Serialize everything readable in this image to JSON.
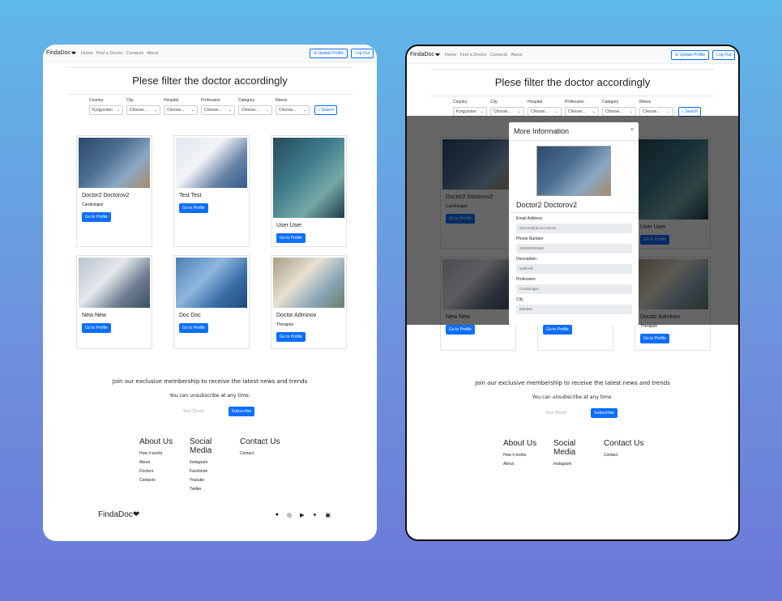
{
  "nav": {
    "brand": "FindaDoc",
    "links": [
      "Home",
      "Find a Doctor",
      "Contacts",
      "About"
    ],
    "update_profile": "⊚ Update Profile",
    "logout": "Log Out"
  },
  "page": {
    "title": "Plese filter the doctor accordingly"
  },
  "filters": {
    "labels": [
      "Country",
      "City",
      "Hospital",
      "Profession",
      "Category",
      "Illness"
    ],
    "values": [
      "Kyrgyzstan",
      "Choose...",
      "Choose...",
      "Choose...",
      "Choose...",
      "Choose..."
    ],
    "search": "⌕ Search"
  },
  "doctors": [
    {
      "name": "Doctor2 Doctorov2",
      "profession": "Cardiologist",
      "button": "Go to Profile"
    },
    {
      "name": "Test Test",
      "profession": "",
      "button": "Go to Profile"
    },
    {
      "name": "User User",
      "profession": "",
      "button": "Go to Profile"
    },
    {
      "name": "New New",
      "profession": "",
      "button": "Go to Profile"
    },
    {
      "name": "Doc Doc",
      "profession": "",
      "button": "Go to Profile"
    },
    {
      "name": "Doctor Adminov",
      "profession": "Therapist",
      "button": "Go to Profile"
    }
  ],
  "newsletter": {
    "title": "Join our exclusive membership to receive the latest news and trends",
    "subtitle": "You can unsubscribe at any time.",
    "placeholder": "Your Email",
    "button": "Subscribe"
  },
  "footer": {
    "about": {
      "title": "About Us",
      "items": [
        "How it works",
        "About",
        "Doctors",
        "Contacts"
      ]
    },
    "social": {
      "title": "Social Media",
      "items": [
        "Instagram",
        "Facebook",
        "Youtube",
        "Twitter"
      ]
    },
    "contact": {
      "title": "Contact Us",
      "items": [
        "Contact"
      ]
    },
    "brand": "FindaDoc"
  },
  "modal": {
    "title": "More Information",
    "close": "×",
    "name": "Doctor2 Doctorov2",
    "fields": [
      {
        "label": "Email Address",
        "value": "doctor2@doctor.doctor"
      },
      {
        "label": "Phone Number",
        "value": "234852390640"
      },
      {
        "label": "Description",
        "value": "asdfcvdr"
      },
      {
        "label": "Profession",
        "value": "Cardiologist"
      },
      {
        "label": "City",
        "value": "Bishkek"
      }
    ]
  },
  "colors": {
    "primary": "#0d6efd",
    "background_top": "#5fb8ea",
    "background_bottom": "#6a78d8"
  }
}
